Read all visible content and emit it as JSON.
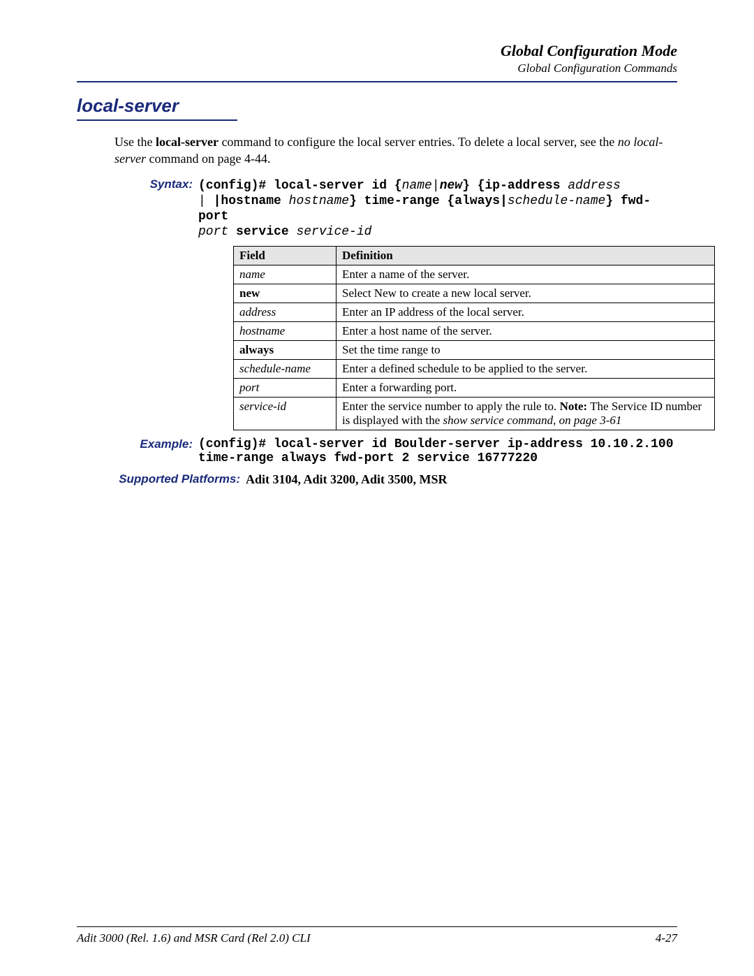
{
  "header": {
    "title": "Global Configuration Mode",
    "subtitle": "Global Configuration Commands"
  },
  "section": {
    "heading": "local-server"
  },
  "intro": {
    "pre": "Use the ",
    "cmd1": "local-server",
    "mid": " command to configure the local server entries. To delete a local server, see the ",
    "nolocal": "no local-server",
    "after": " command on page 4-44."
  },
  "syntax": {
    "label": "Syntax:",
    "s1": "(config)# local-server id {",
    "s2": "name",
    "s3": "|",
    "s4": "new",
    "s5": "} {ip-address ",
    "s6": "address",
    "s7": " |hostname ",
    "s8": "hostname",
    "s9": "} time-range {always|",
    "s10": "schedule-name",
    "s11": "} fwd-port ",
    "s12": "port",
    "s13": " service ",
    "s14": "service-id"
  },
  "table": {
    "col1": "Field",
    "col2": "Definition",
    "rows": [
      {
        "field": "name",
        "field_style": "ital",
        "def": "Enter a name of the server."
      },
      {
        "field": "new",
        "field_style": "bold",
        "def": "Select New to create a new local server."
      },
      {
        "field": "address",
        "field_style": "ital",
        "def": "Enter an IP address of the local server."
      },
      {
        "field": "hostname",
        "field_style": "ital",
        "def": "Enter a host name of the server."
      },
      {
        "field": "always",
        "field_style": "bold",
        "def": "Set the time range to"
      },
      {
        "field": "schedule-name",
        "field_style": "ital",
        "def": "Enter a defined schedule to be applied to the server."
      },
      {
        "field": "port",
        "field_style": "ital",
        "def": "Enter a forwarding port."
      },
      {
        "field": "service-id",
        "field_style": "ital",
        "def_pre": "Enter the service number to apply the rule to. ",
        "def_note_label": "Note:",
        "def_note_text": " The Service ID number is displayed with the ",
        "def_ital": "show service command, on page 3-61"
      }
    ]
  },
  "example": {
    "label": "Example:",
    "line1": "(config)# local-server id Boulder-server ip-address 10.10.2.100",
    "line2": "time-range always fwd-port 2 service 16777220"
  },
  "platforms": {
    "label": "Supported Platforms:",
    "value": "Adit 3104, Adit 3200, Adit 3500, MSR"
  },
  "footer": {
    "left": "Adit 3000 (Rel. 1.6) and MSR Card (Rel 2.0) CLI",
    "right": "4-27"
  }
}
